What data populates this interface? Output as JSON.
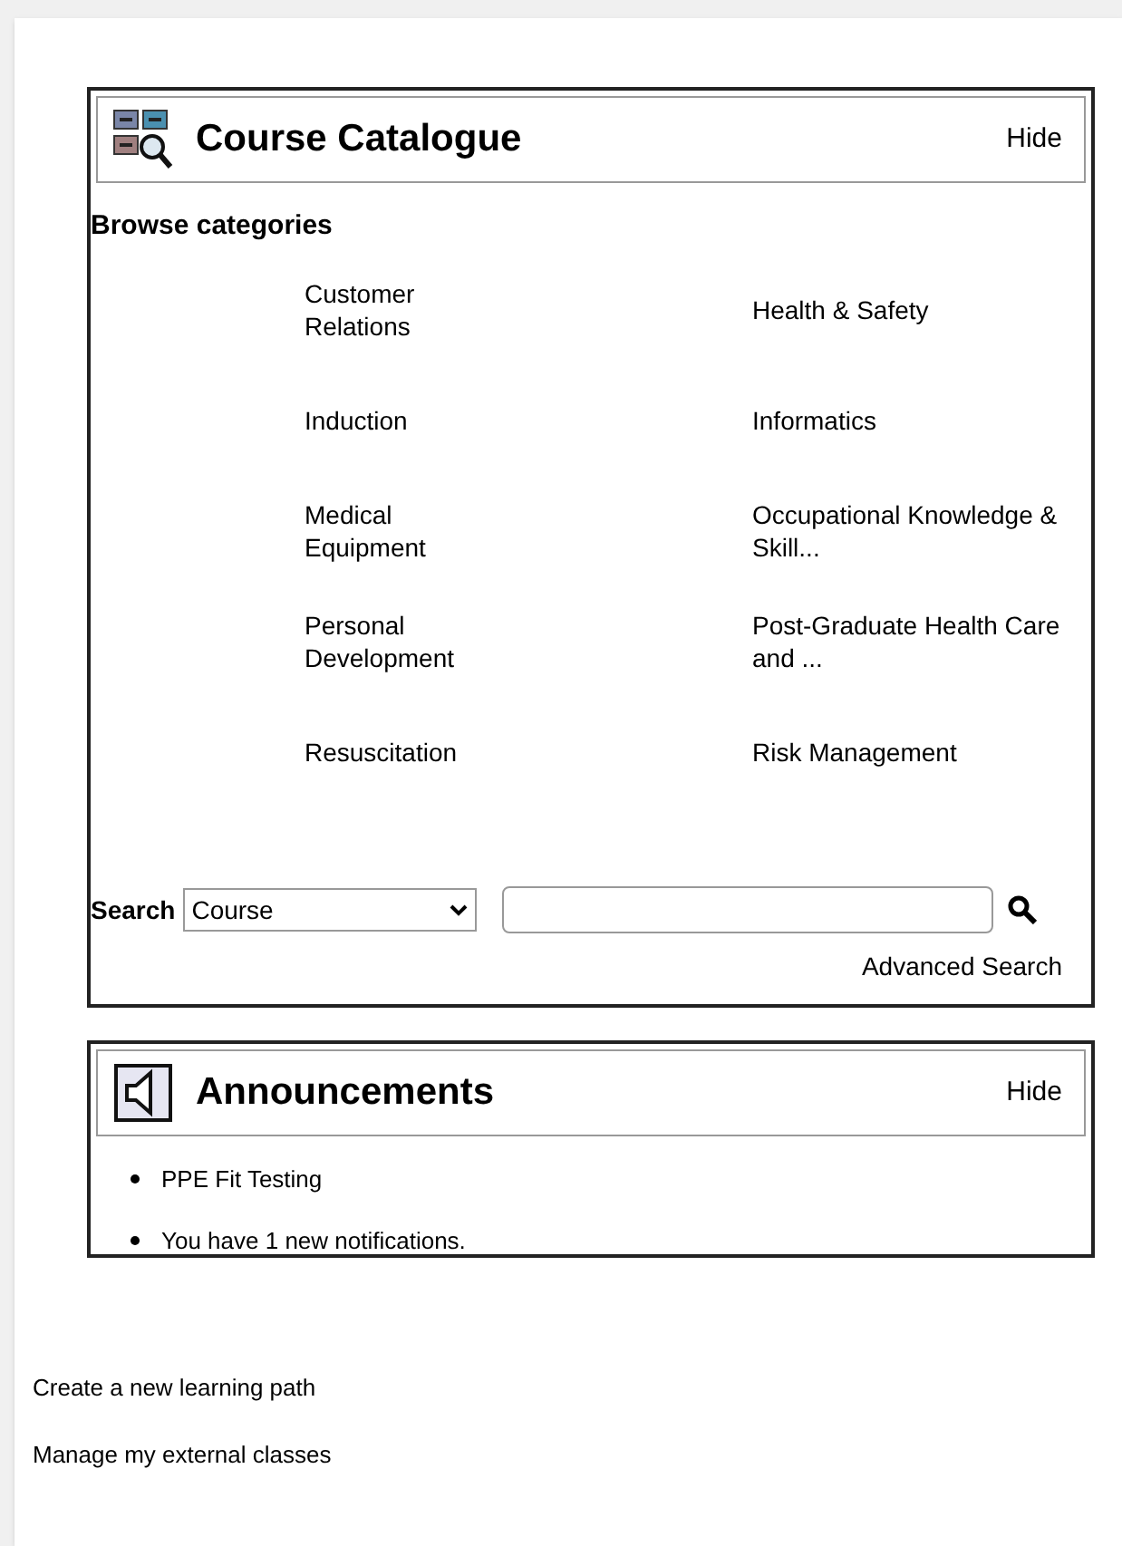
{
  "catalogue": {
    "title": "Course Catalogue",
    "hide": "Hide",
    "browse_heading": "Browse categories",
    "categories": [
      "Customer Relations",
      "Health & Safety",
      "Induction",
      "Informatics",
      "Medical Equipment",
      "Occupational Knowledge & Skill...",
      "Personal Development",
      "Post-Graduate Health Care and ...",
      "Resuscitation",
      "Risk Management"
    ],
    "search": {
      "label": "Search",
      "scope": "Course"
    },
    "advanced_search": "Advanced Search"
  },
  "announcements": {
    "title": "Announcements",
    "hide": "Hide",
    "items": [
      "PPE Fit Testing",
      "You have 1 new notifications."
    ]
  },
  "links": [
    "Create a new learning path",
    "Manage my external classes"
  ]
}
